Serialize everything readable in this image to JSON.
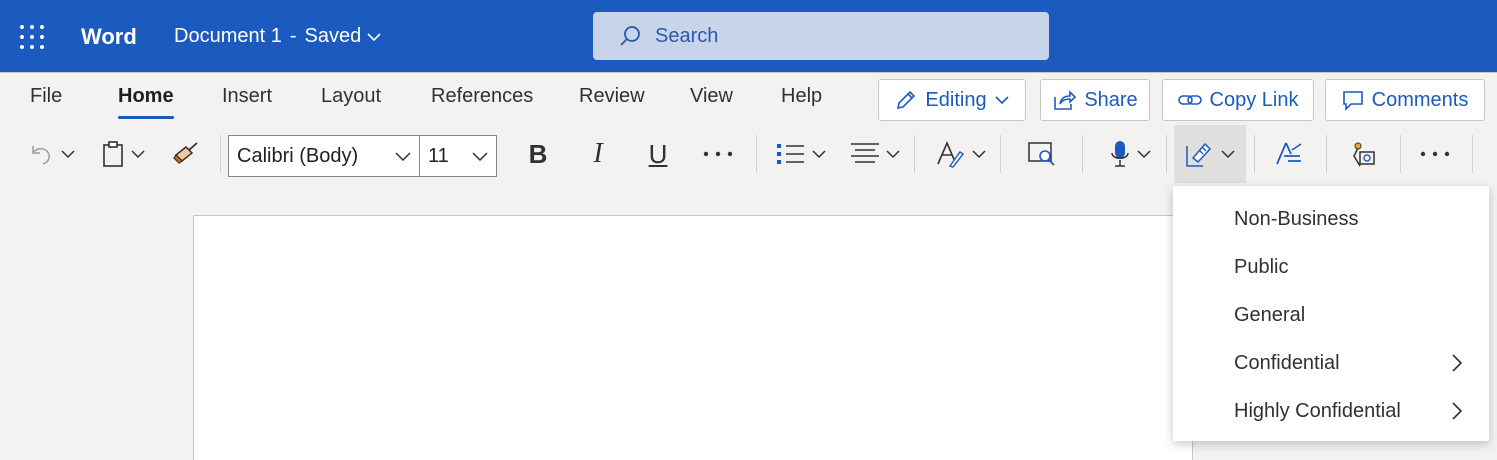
{
  "titlebar": {
    "app_name": "Word",
    "document_name": "Document 1",
    "separator": "-",
    "save_status": "Saved",
    "search_placeholder": "Search",
    "background_color": "#1b5bbf"
  },
  "ribbon": {
    "tabs": [
      {
        "label": "File",
        "active": false
      },
      {
        "label": "Home",
        "active": true
      },
      {
        "label": "Insert",
        "active": false
      },
      {
        "label": "Layout",
        "active": false
      },
      {
        "label": "References",
        "active": false
      },
      {
        "label": "Review",
        "active": false
      },
      {
        "label": "View",
        "active": false
      },
      {
        "label": "Help",
        "active": false
      }
    ],
    "actions": {
      "editing": "Editing",
      "share": "Share",
      "copy_link": "Copy Link",
      "comments": "Comments"
    },
    "toolbar": {
      "font_name": "Calibri (Body)",
      "font_size": "11",
      "bold": "B",
      "italic": "I",
      "underline": "U",
      "more": "···",
      "icons": [
        "undo-icon",
        "paste-icon",
        "format-painter-icon",
        "bullets-icon",
        "align-icon",
        "styles-icon",
        "find-icon",
        "dictate-icon",
        "sensitivity-icon",
        "editor-icon",
        "designer-icon",
        "more-options-icon"
      ]
    }
  },
  "sensitivity_menu": {
    "items": [
      {
        "label": "Non-Business",
        "has_submenu": false
      },
      {
        "label": "Public",
        "has_submenu": false
      },
      {
        "label": "General",
        "has_submenu": false
      },
      {
        "label": "Confidential",
        "has_submenu": true
      },
      {
        "label": "Highly Confidential",
        "has_submenu": true
      }
    ]
  },
  "colors": {
    "accent": "#1b5bbf",
    "ribbon_bg": "#f3f2f1",
    "canvas_bg": "#f3f2f1"
  }
}
